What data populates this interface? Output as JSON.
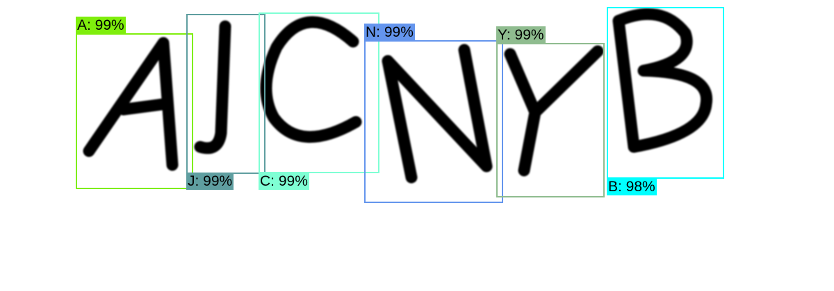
{
  "detections": [
    {
      "label": "A: 99%",
      "letter": "A",
      "color": "#7fee0c"
    },
    {
      "label": "J: 99%",
      "letter": "J",
      "color": "#5f9ea0"
    },
    {
      "label": "C: 99%",
      "letter": "C",
      "color": "#7fffd4"
    },
    {
      "label": "N: 99%",
      "letter": "N",
      "color": "#6495ed"
    },
    {
      "label": "Y: 99%",
      "letter": "Y",
      "color": "#8fbc8f"
    },
    {
      "label": "B: 98%",
      "letter": "B",
      "color": "#00ffff"
    }
  ]
}
